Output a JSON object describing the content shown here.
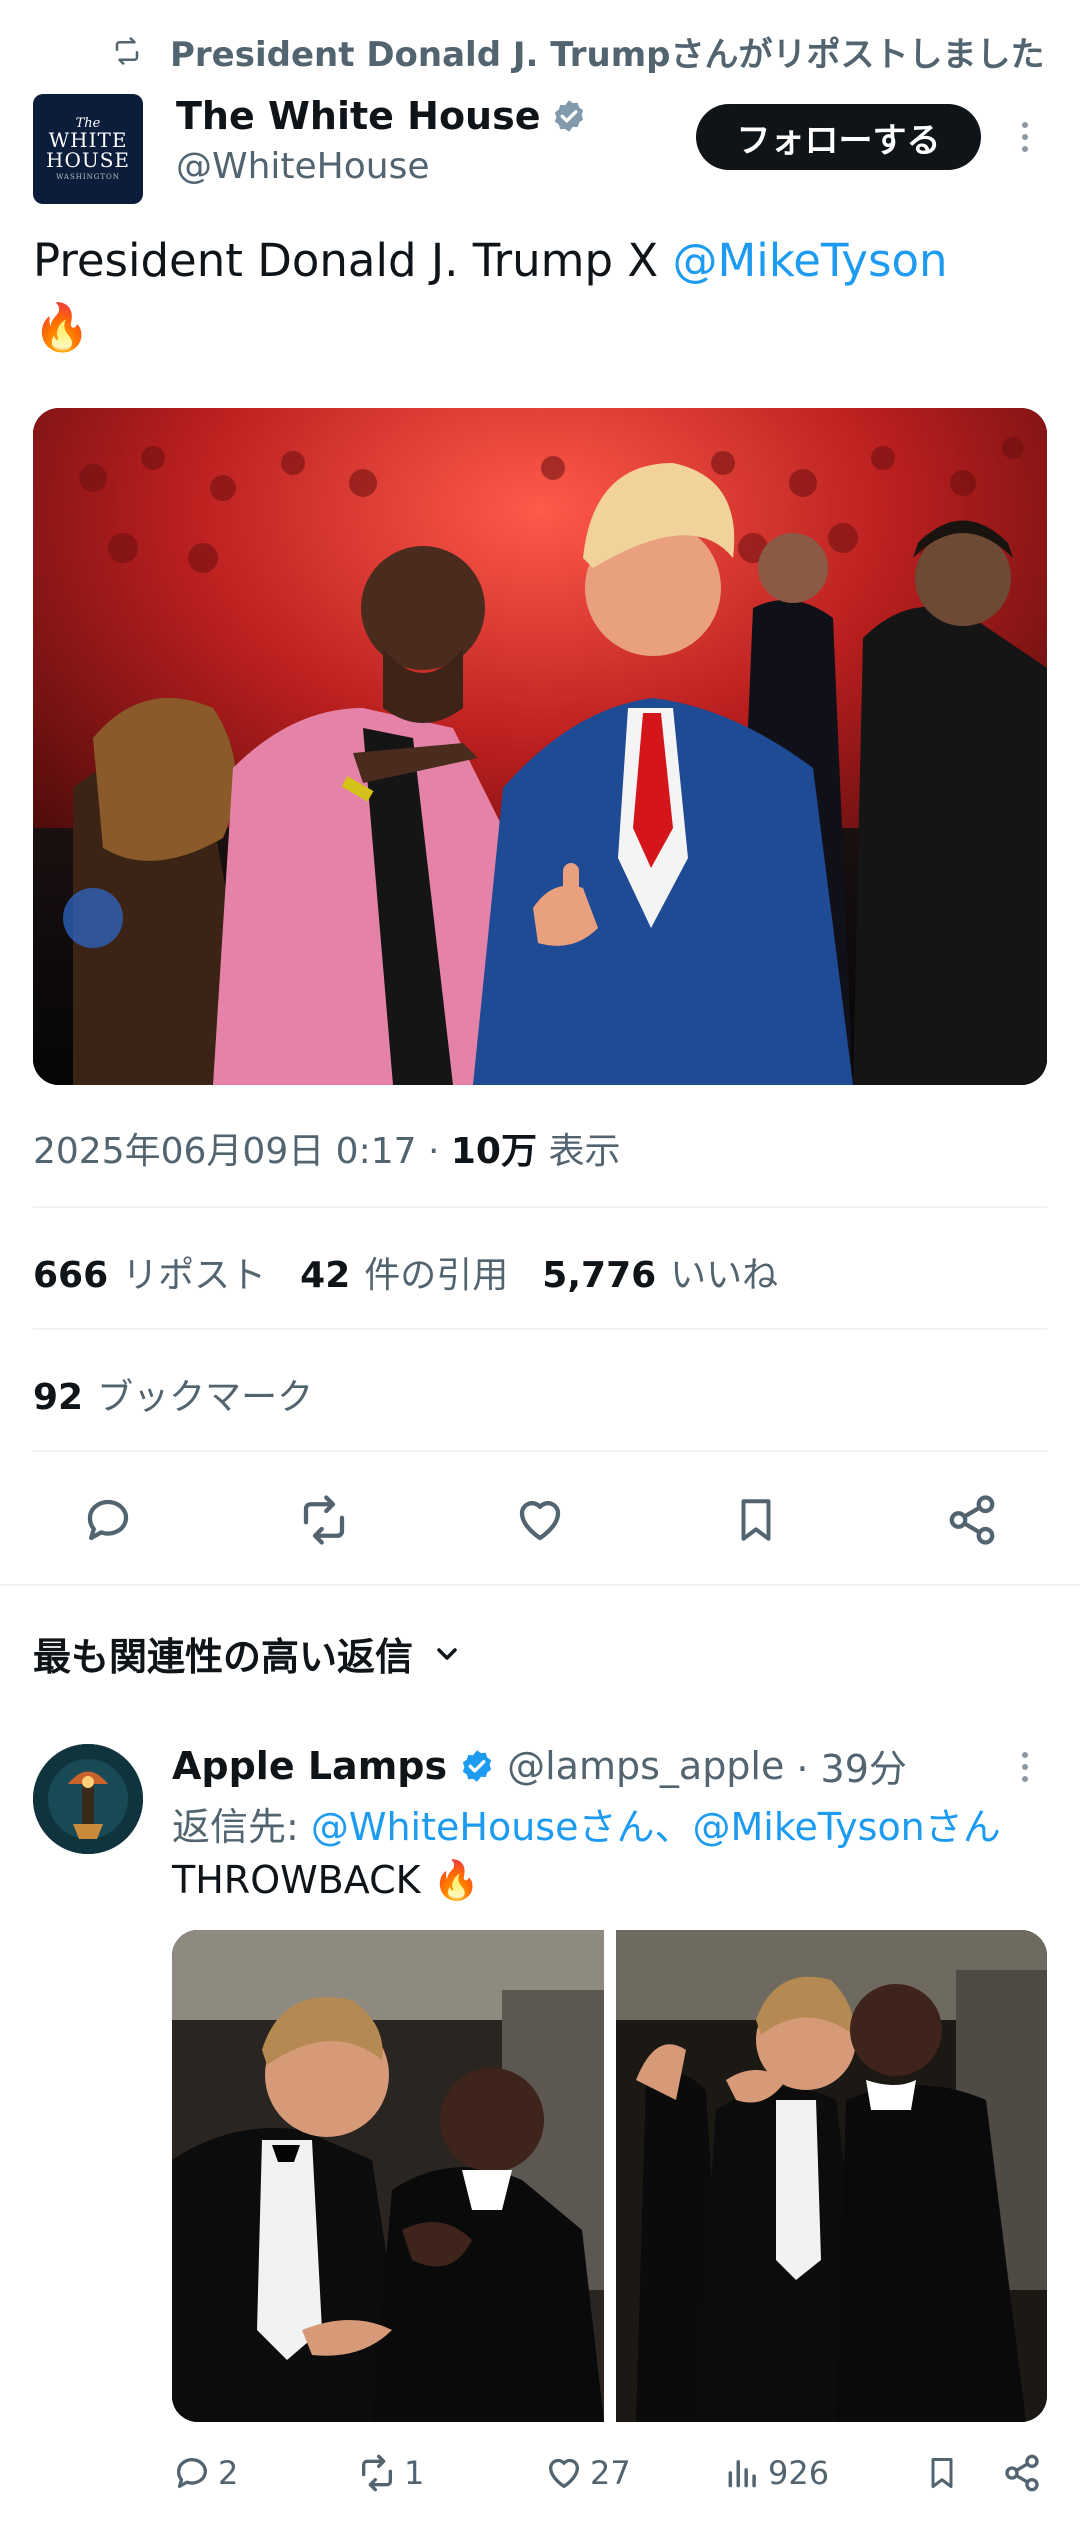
{
  "repost": {
    "text": "President Donald J. Trumpさんがリポストしました",
    "icon": "repost-icon"
  },
  "author": {
    "name": "The White House",
    "handle": "@WhiteHouse",
    "verified": true,
    "avatar": {
      "line_the": "The",
      "line1": "WHITE",
      "line2": "HOUSE",
      "sub": "WASHINGTON"
    },
    "follow_label": "フォローする"
  },
  "tweet": {
    "text_before": "President Donald J. Trump X ",
    "mention": "@MikeTyson",
    "emoji": "🔥"
  },
  "meta": {
    "datetime": "2025年06月09日 0:17",
    "dot": " · ",
    "views_count": "10万",
    "views_label": "表示"
  },
  "stats": {
    "reposts": "666",
    "reposts_label": "リポスト",
    "quotes": "42",
    "quotes_label": "件の引用",
    "likes": "5,776",
    "likes_label": "いいね",
    "bookmarks": "92",
    "bookmarks_label": "ブックマーク"
  },
  "actions": [
    "reply-icon",
    "repost-icon",
    "like-icon",
    "bookmark-icon",
    "share-icon"
  ],
  "replies_header": {
    "label": "最も関連性の高い返信"
  },
  "reply": {
    "name": "Apple Lamps",
    "handle": "@lamps_apple",
    "time": "· 39分",
    "reply_to_prefix": "返信先: ",
    "reply_to_1": "@WhiteHouseさん",
    "reply_to_sep": "、",
    "reply_to_2": "@MikeTysonさん",
    "text": "THROWBACK ",
    "emoji": "🔥",
    "counts": {
      "replies": "2",
      "reposts": "1",
      "likes": "27",
      "views": "926"
    }
  },
  "colors": {
    "accent": "#1d9bf0",
    "text": "#0f1419",
    "muted": "#536471",
    "verified": "#1d9bf0"
  }
}
